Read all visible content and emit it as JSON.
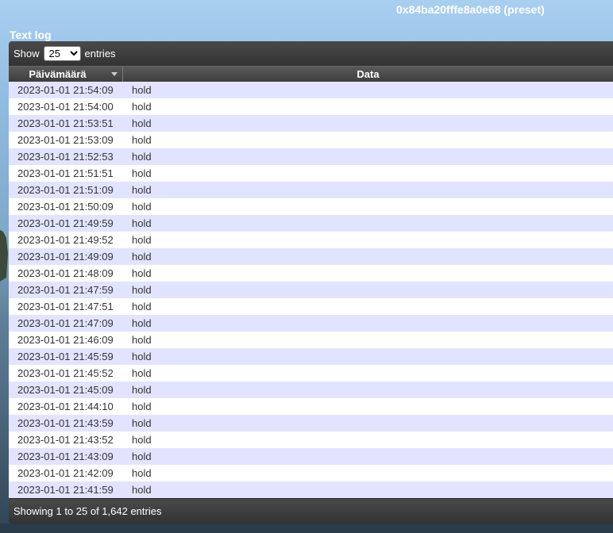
{
  "device_title": "0x84ba20fffe8a0e68 (preset)",
  "section_title": "Text log",
  "toolbar": {
    "show_label": "Show",
    "page_size": "25",
    "entries_label": "entries"
  },
  "table": {
    "columns": [
      "Päivämäärä",
      "Data"
    ],
    "rows": [
      {
        "date": "2023-01-01 21:54:09",
        "data": "hold"
      },
      {
        "date": "2023-01-01 21:54:00",
        "data": "hold"
      },
      {
        "date": "2023-01-01 21:53:51",
        "data": "hold"
      },
      {
        "date": "2023-01-01 21:53:09",
        "data": "hold"
      },
      {
        "date": "2023-01-01 21:52:53",
        "data": "hold"
      },
      {
        "date": "2023-01-01 21:51:51",
        "data": "hold"
      },
      {
        "date": "2023-01-01 21:51:09",
        "data": "hold"
      },
      {
        "date": "2023-01-01 21:50:09",
        "data": "hold"
      },
      {
        "date": "2023-01-01 21:49:59",
        "data": "hold"
      },
      {
        "date": "2023-01-01 21:49:52",
        "data": "hold"
      },
      {
        "date": "2023-01-01 21:49:09",
        "data": "hold"
      },
      {
        "date": "2023-01-01 21:48:09",
        "data": "hold"
      },
      {
        "date": "2023-01-01 21:47:59",
        "data": "hold"
      },
      {
        "date": "2023-01-01 21:47:51",
        "data": "hold"
      },
      {
        "date": "2023-01-01 21:47:09",
        "data": "hold"
      },
      {
        "date": "2023-01-01 21:46:09",
        "data": "hold"
      },
      {
        "date": "2023-01-01 21:45:59",
        "data": "hold"
      },
      {
        "date": "2023-01-01 21:45:52",
        "data": "hold"
      },
      {
        "date": "2023-01-01 21:45:09",
        "data": "hold"
      },
      {
        "date": "2023-01-01 21:44:10",
        "data": "hold"
      },
      {
        "date": "2023-01-01 21:43:59",
        "data": "hold"
      },
      {
        "date": "2023-01-01 21:43:52",
        "data": "hold"
      },
      {
        "date": "2023-01-01 21:43:09",
        "data": "hold"
      },
      {
        "date": "2023-01-01 21:42:09",
        "data": "hold"
      },
      {
        "date": "2023-01-01 21:41:59",
        "data": "hold"
      }
    ]
  },
  "footer": {
    "info": "Showing 1 to 25 of 1,642 entries"
  },
  "colors": {
    "row_odd": "#e2e4ff",
    "row_even": "#ffffff",
    "bar": "#3a3a3a"
  },
  "icons": {
    "sort": "sort-desc-icon"
  }
}
